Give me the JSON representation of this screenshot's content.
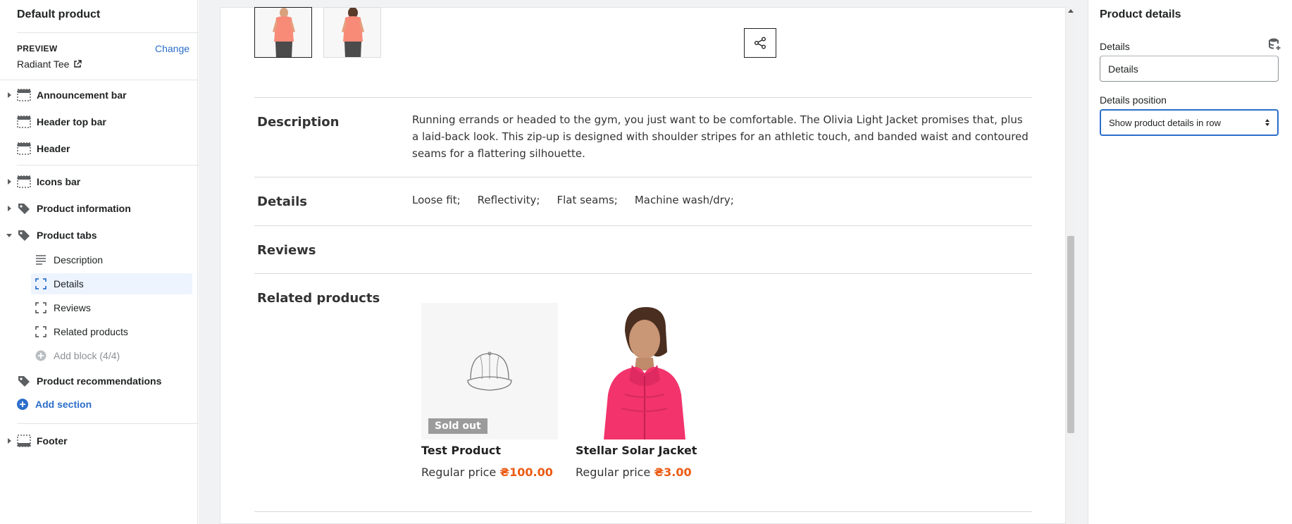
{
  "sidebar": {
    "title": "Default product",
    "preview_label": "PREVIEW",
    "preview_change": "Change",
    "preview_value": "Radiant Tee",
    "sections": [
      {
        "label": "Announcement bar",
        "icon": "section-dashed-top-icon",
        "collapsible": true
      },
      {
        "label": "Header top bar",
        "icon": "section-header-icon",
        "collapsible": false
      },
      {
        "label": "Header",
        "icon": "section-header-icon",
        "collapsible": false
      },
      {
        "label": "Icons bar",
        "icon": "section-dashed-top-icon",
        "collapsible": true
      },
      {
        "label": "Product information",
        "icon": "tag-icon",
        "collapsible": true
      },
      {
        "label": "Product tabs",
        "icon": "tag-icon",
        "collapsible": true,
        "expanded": true
      },
      {
        "label": "Product recommendations",
        "icon": "tag-icon",
        "collapsible": false
      },
      {
        "label": "Footer",
        "icon": "section-footer-icon",
        "collapsible": true
      }
    ],
    "blocks": [
      {
        "label": "Description",
        "icon": "text-lines-icon"
      },
      {
        "label": "Details",
        "icon": "block-bracket-icon",
        "active": true
      },
      {
        "label": "Reviews",
        "icon": "block-bracket-icon"
      },
      {
        "label": "Related products",
        "icon": "block-bracket-icon"
      },
      {
        "label": "Add block (4/4)",
        "icon": "add-circle-icon",
        "disabled": true
      }
    ],
    "add_section": "Add section"
  },
  "product": {
    "description_heading": "Description",
    "description_text": "Running errands or headed to the gym, you just want to be comfortable. The Olivia Light Jacket promises that, plus a laid-back look. This zip-up is designed with shoulder stripes for an athletic touch, and banded waist and contoured seams for a flattering silhouette.",
    "details_heading": "Details",
    "details": [
      "Loose fit;",
      "Reflectivity;",
      "Flat seams;",
      "Machine wash/dry;"
    ],
    "reviews_heading": "Reviews",
    "related_heading": "Related products",
    "related": [
      {
        "name": "Test Product",
        "price_label": "Regular price",
        "price": "₴100.00",
        "badge": "Sold out"
      },
      {
        "name": "Stellar Solar Jacket",
        "price_label": "Regular price",
        "price": "₴3.00"
      }
    ]
  },
  "settings": {
    "title": "Product details",
    "details_label": "Details",
    "details_value": "Details",
    "position_label": "Details position",
    "position_value": "Show product details in row"
  },
  "colors": {
    "accent": "#2c6ecb",
    "price": "#ec5b13",
    "active_block_bg": "#edf4fe"
  }
}
